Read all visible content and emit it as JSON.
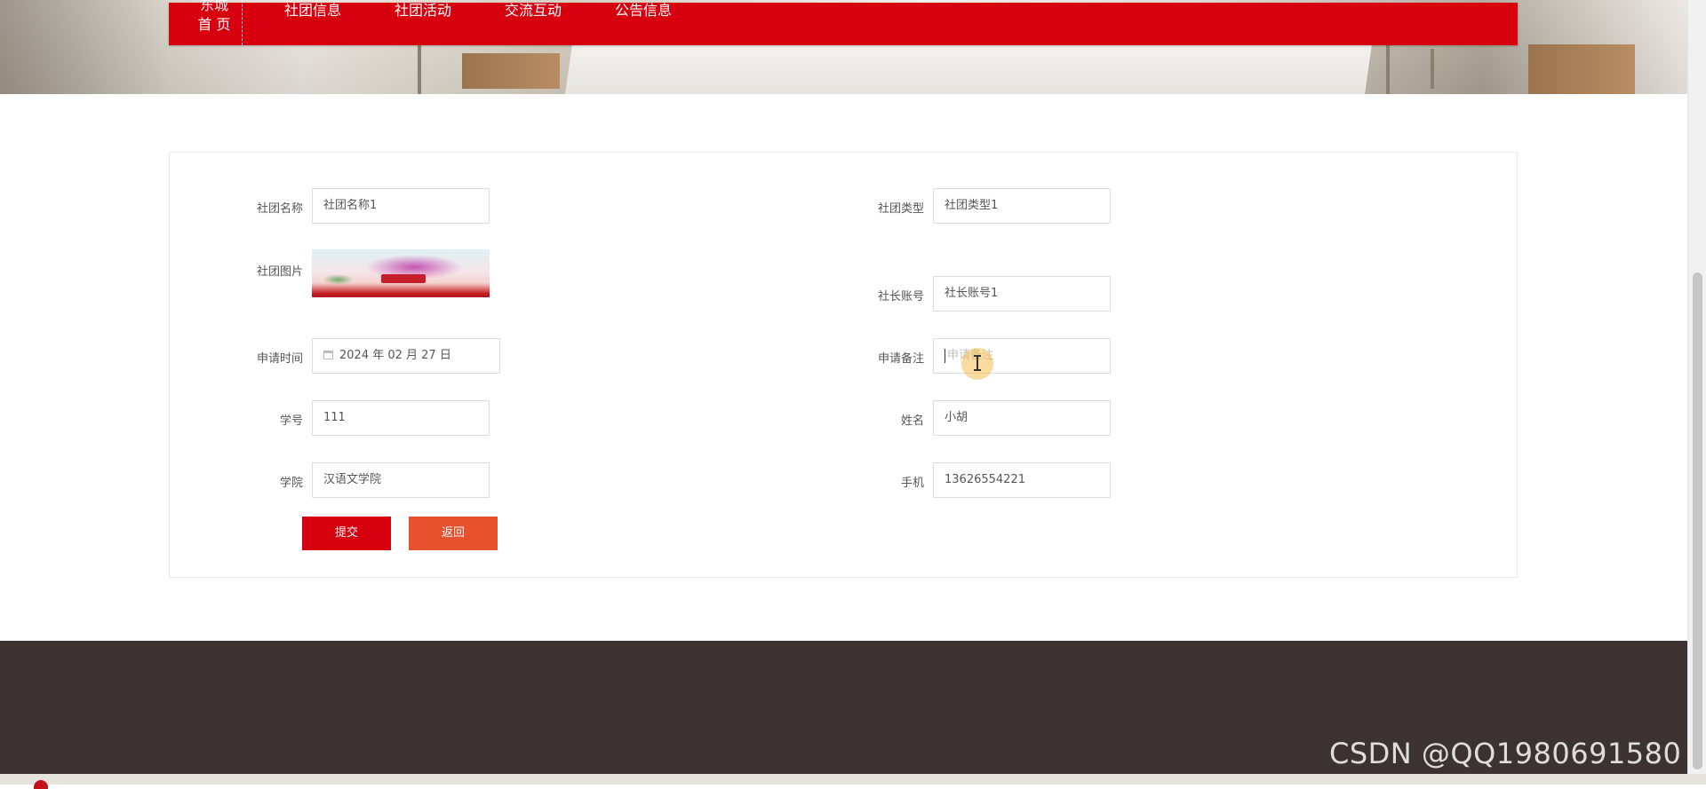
{
  "nav": {
    "home_top": "东城",
    "home": "首 页",
    "items": [
      "社团信息",
      "社团活动",
      "交流互动",
      "公告信息"
    ]
  },
  "form": {
    "club_name": {
      "label": "社团名称",
      "value": "社团名称1"
    },
    "club_type": {
      "label": "社团类型",
      "value": "社团类型1"
    },
    "club_image": {
      "label": "社团图片"
    },
    "president_account": {
      "label": "社长账号",
      "value": "社长账号1"
    },
    "apply_time": {
      "label": "申请时间",
      "value": "2024 年 02 月 27 日"
    },
    "apply_note": {
      "label": "申请备注",
      "placeholder": "申请备注"
    },
    "student_id": {
      "label": "学号",
      "value": "111"
    },
    "name": {
      "label": "姓名",
      "value": "小胡"
    },
    "college": {
      "label": "学院",
      "value": "汉语文学院"
    },
    "phone": {
      "label": "手机",
      "value": "13626554221"
    },
    "submit_label": "提交",
    "back_label": "返回"
  },
  "watermark": "CSDN @QQ1980691580",
  "colors": {
    "primary_red": "#d7000f",
    "back_orange": "#e8512e",
    "footer_bg": "#3c3231"
  }
}
